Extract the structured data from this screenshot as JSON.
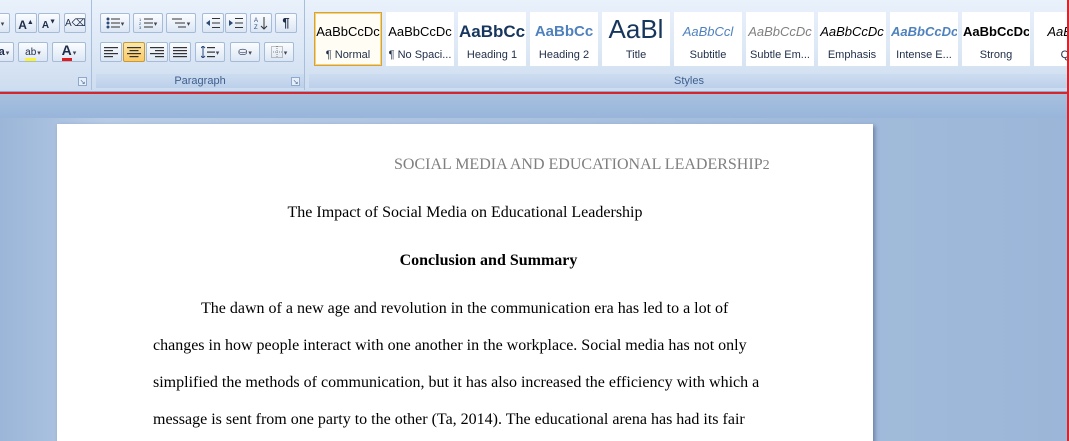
{
  "ribbon": {
    "groups": {
      "paragraph_label": "Paragraph",
      "styles_label": "Styles"
    },
    "styles": [
      {
        "preview": "AaBbCcDc",
        "name": "¶ Normal",
        "selected": true
      },
      {
        "preview": "AaBbCcDc",
        "name": "¶ No Spaci..."
      },
      {
        "preview": "AaBbCc",
        "name": "Heading 1"
      },
      {
        "preview": "AaBbCc",
        "name": "Heading 2"
      },
      {
        "preview": "AaBl",
        "name": "Title"
      },
      {
        "preview": "AaBbCcl",
        "name": "Subtitle"
      },
      {
        "preview": "AaBbCcDc",
        "name": "Subtle Em..."
      },
      {
        "preview": "AaBbCcDc",
        "name": "Emphasis"
      },
      {
        "preview": "AaBbCcDc",
        "name": "Intense E..."
      },
      {
        "preview": "AaBbCcDc",
        "name": "Strong"
      },
      {
        "preview": "AaBbC",
        "name": "Qu"
      }
    ],
    "font_color": "#e31b1b",
    "highlight_color": "#f8f337",
    "partial_font_label": "a",
    "para_mark": "¶"
  },
  "document": {
    "running_head": "SOCIAL MEDIA AND EDUCATIONAL LEADERSHIP",
    "page_number": "2",
    "title": "The Impact of Social Media on Educational Leadership",
    "section_heading": "Conclusion and Summary",
    "body_lines": [
      "The dawn of a new age and revolution in the communication era has led to a lot of",
      "changes in how people interact with one another in the workplace. Social media has not only",
      "simplified the methods of communication, but it has also increased the efficiency with which a",
      "message is sent from one party to the other (Ta, 2014). The educational arena has had its fair"
    ]
  }
}
